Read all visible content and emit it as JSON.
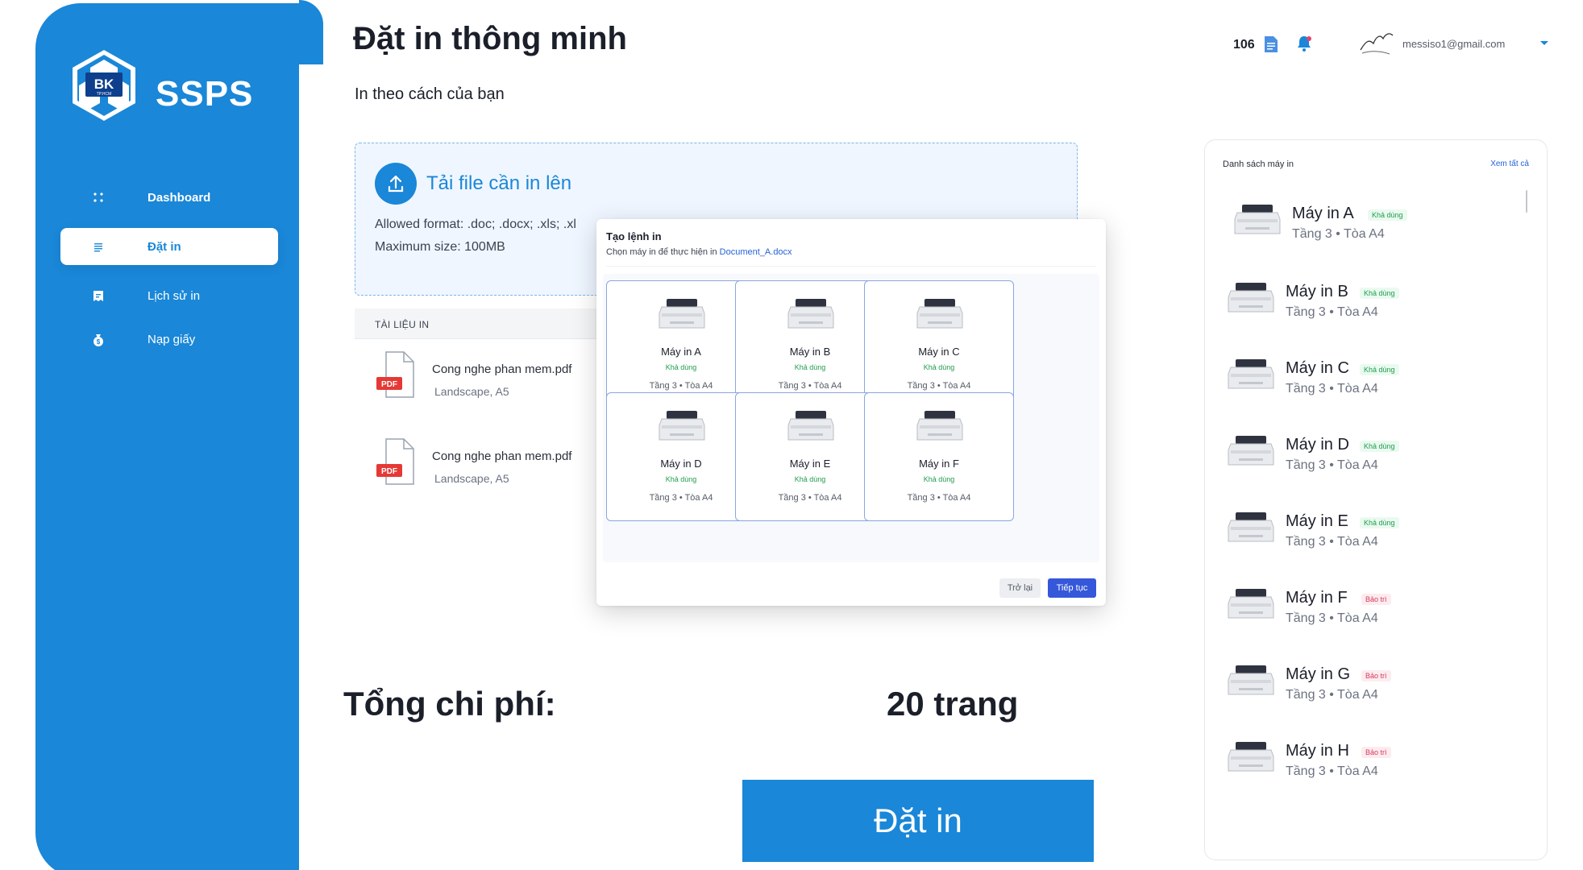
{
  "app": {
    "brand": "SSPS",
    "logo_text": "BK",
    "logo_subtext": "TP.HCM"
  },
  "sidebar": {
    "items": [
      {
        "label": "Dashboard",
        "icon": "dots-grid-icon",
        "active": false
      },
      {
        "label": "Đặt in",
        "icon": "list-lines-icon",
        "active": true
      },
      {
        "label": "Lịch sử in",
        "icon": "history-icon",
        "active": false
      },
      {
        "label": "Nạp giấy",
        "icon": "money-bag-icon",
        "active": false
      }
    ]
  },
  "header": {
    "title": "Đặt in thông minh",
    "subtitle": "In theo cách của bạn",
    "page_count": "106",
    "email": "messiso1@gmail.com"
  },
  "upload": {
    "title": "Tải file cần in lên",
    "allowed_format": "Allowed format: .doc; .docx; .xls; .xl",
    "max_size": "Maximum size: 100MB"
  },
  "documents": {
    "header": "TÀI LIỆU IN",
    "items": [
      {
        "name": "Cong nghe phan mem.pdf",
        "meta": "Landscape, A5",
        "badge": "PDF"
      },
      {
        "name": "Cong nghe phan mem.pdf",
        "meta": "Landscape, A5",
        "badge": "PDF"
      }
    ]
  },
  "summary": {
    "total_label": "Tổng chi phí:",
    "total_value": "20 trang",
    "print_button": "Đặt in"
  },
  "modal": {
    "title": "Tạo lệnh in",
    "subtitle_prefix": "Chọn máy in để thực hiện in ",
    "document": "Document_A.docx",
    "printers": [
      {
        "name": "Máy in A",
        "status": "Khả dùng",
        "location": "Tầng 3 • Tòa A4"
      },
      {
        "name": "Máy in B",
        "status": "Khả dùng",
        "location": "Tầng 3 • Tòa A4"
      },
      {
        "name": "Máy in C",
        "status": "Khả dùng",
        "location": "Tầng 3 • Tòa A4"
      },
      {
        "name": "Máy in D",
        "status": "Khả dùng",
        "location": "Tầng 3 • Tòa A4"
      },
      {
        "name": "Máy in E",
        "status": "Khả dùng",
        "location": "Tầng 3 • Tòa A4"
      },
      {
        "name": "Máy in F",
        "status": "Khả dùng",
        "location": "Tầng 3 • Tòa A4"
      }
    ],
    "back_button": "Trở lại",
    "next_button": "Tiếp tục"
  },
  "printer_panel": {
    "title": "Danh sách máy in",
    "view_all": "Xem tất cả",
    "items": [
      {
        "name": "Máy in A",
        "status": "Khả dùng",
        "location": "Tầng 3 • Tòa A4"
      },
      {
        "name": "Máy in B",
        "status": "Khả dùng",
        "location": "Tầng 3 • Tòa A4"
      },
      {
        "name": "Máy in C",
        "status": "Khả dùng",
        "location": "Tầng 3 • Tòa A4"
      },
      {
        "name": "Máy in D",
        "status": "Khả dùng",
        "location": "Tầng 3 • Tòa A4"
      },
      {
        "name": "Máy in E",
        "status": "Khả dùng",
        "location": "Tầng 3 • Tòa A4"
      },
      {
        "name": "Máy in F",
        "status": "Bảo trì",
        "location": "Tầng 3 • Tòa A4"
      },
      {
        "name": "Máy in G",
        "status": "Bảo trì",
        "location": "Tầng 3 • Tòa A4"
      },
      {
        "name": "Máy in H",
        "status": "Bảo trì",
        "location": "Tầng 3 • Tòa A4"
      }
    ]
  },
  "colors": {
    "primary": "#1a87d8",
    "available": "#1f9d4c",
    "maintenance": "#d43a5c",
    "modal_primary": "#3557d9"
  }
}
